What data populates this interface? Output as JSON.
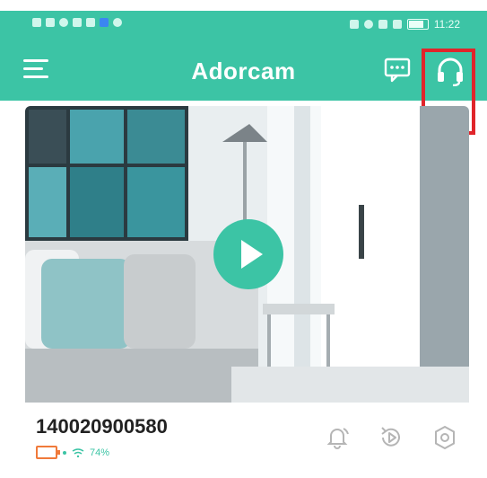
{
  "app": {
    "title": "Adorcam"
  },
  "statusbar": {
    "time": "11:22"
  },
  "device": {
    "id": "140020900580",
    "signal": "74%"
  },
  "colors": {
    "brand": "#3cc4a5",
    "highlight": "#e0252b",
    "battery": "#f07a3a"
  },
  "icons": {
    "menu": "hamburger-menu-icon",
    "message": "message-icon",
    "support": "headset-icon",
    "play": "play-icon",
    "alarm": "alarm-bell-icon",
    "playback": "playback-icon",
    "settings": "gear-icon"
  }
}
